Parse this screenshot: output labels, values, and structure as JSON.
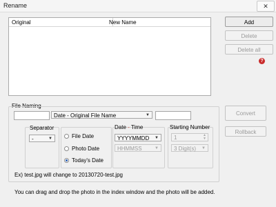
{
  "window": {
    "title": "Rename",
    "close": "✕"
  },
  "list": {
    "col_original": "Original",
    "col_new_name": "New Name"
  },
  "buttons": {
    "add": "Add",
    "delete": "Delete",
    "delete_all": "Delete all",
    "convert": "Convert",
    "rollback": "Rollback"
  },
  "help": {
    "glyph": "?"
  },
  "file_naming": {
    "label": "File Naming",
    "prefix_value": "",
    "mode_selected": "Date - Original File Name",
    "suffix_value": "",
    "separator": {
      "label": "Separator",
      "selected": "-"
    },
    "date_source": {
      "options": [
        "File Date",
        "Photo Date",
        "Today's Date"
      ],
      "selected_index": 2
    },
    "date_time": {
      "label_date": "Date",
      "label_sep": " - ",
      "label_time": "Time",
      "date_format": "YYYYMMDD",
      "time_format": "HHMMSS"
    },
    "starting_number": {
      "label": "Starting Number",
      "value": "1",
      "digits": "3 Digit(s)"
    },
    "example": "Ex) test.jpg will change to 20130720-test.jpg"
  },
  "footer_note": "You can drag and drop the photo in the index window and the photo will be added."
}
